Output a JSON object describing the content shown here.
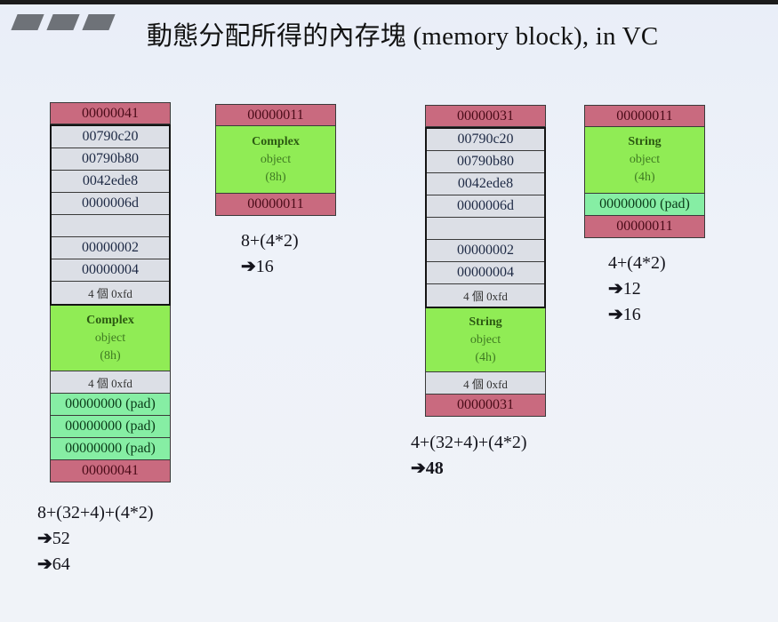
{
  "title": "動態分配所得的內存塊 (memory block), in VC",
  "logo_icon": "three-parallelogram-bars",
  "colors": {
    "header_cookie": "#c96a7f",
    "debug_header": "#dcdfe6",
    "object": "#90ec55",
    "pad": "#86eea4"
  },
  "arrow_glyph": "➔",
  "blocks": [
    {
      "id": "complex-debug",
      "cookie_top": "00000041",
      "debug_header": [
        "00790c20",
        "00790b80",
        "0042ede8",
        "0000006d",
        "",
        "00000002",
        "00000004",
        "4 個 0xfd"
      ],
      "object": {
        "name": "Complex",
        "word": "object",
        "size": "(8h)"
      },
      "guard": "4 個 0xfd",
      "pads": [
        "00000000 (pad)",
        "00000000 (pad)",
        "00000000 (pad)"
      ],
      "cookie_bottom": "00000041",
      "formula": "8+(32+4)+(4*2)",
      "results": [
        "52",
        "64"
      ]
    },
    {
      "id": "complex-release",
      "cookie_top": "00000011",
      "object": {
        "name": "Complex",
        "word": "object",
        "size": "(8h)"
      },
      "cookie_bottom": "00000011",
      "formula": "8+(4*2)",
      "results": [
        "16"
      ]
    },
    {
      "id": "string-debug",
      "cookie_top": "00000031",
      "debug_header": [
        "00790c20",
        "00790b80",
        "0042ede8",
        "0000006d",
        "",
        "00000002",
        "00000004",
        "4 個 0xfd"
      ],
      "object": {
        "name": "String",
        "word": "object",
        "size": "(4h)"
      },
      "guard": "4 個 0xfd",
      "cookie_bottom": "00000031",
      "formula": "4+(32+4)+(4*2)",
      "results": [
        "48"
      ]
    },
    {
      "id": "string-release",
      "cookie_top": "00000011",
      "object": {
        "name": "String",
        "word": "object",
        "size": "(4h)"
      },
      "pads": [
        "00000000 (pad)"
      ],
      "cookie_bottom": "00000011",
      "formula": "4+(4*2)",
      "results": [
        "12",
        "16"
      ]
    }
  ]
}
